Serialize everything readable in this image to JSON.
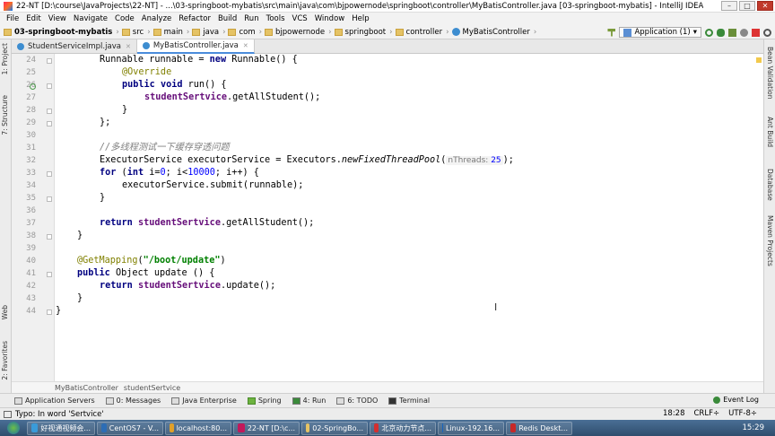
{
  "window": {
    "title": "22-NT [D:\\course\\JavaProjects\\22-NT] - ...\\03-springboot-mybatis\\src\\main\\java\\com\\bjpowernode\\springboot\\controller\\MyBatisController.java [03-springboot-mybatis] - IntelliJ IDEA"
  },
  "menu": [
    "File",
    "Edit",
    "View",
    "Navigate",
    "Code",
    "Analyze",
    "Refactor",
    "Build",
    "Run",
    "Tools",
    "VCS",
    "Window",
    "Help"
  ],
  "breadcrumb": [
    "03-springboot-mybatis",
    "src",
    "main",
    "java",
    "com",
    "bjpowernode",
    "springboot",
    "controller",
    "MyBatisController"
  ],
  "run_config": "Application (1)",
  "tabs": [
    {
      "label": "StudentServiceImpl.java"
    },
    {
      "label": "MyBatisController.java"
    }
  ],
  "left_tools": [
    "1: Project",
    "7: Structure",
    "Web",
    "2: Favorites"
  ],
  "right_tools": [
    "Bean Validation",
    "Ant Build",
    "Database",
    "Maven Projects"
  ],
  "line_numbers": [
    "24",
    "25",
    "26",
    "27",
    "28",
    "29",
    "30",
    "31",
    "32",
    "33",
    "34",
    "35",
    "36",
    "37",
    "38",
    "39",
    "40",
    "41",
    "42",
    "43",
    "44"
  ],
  "code": {
    "l24": {
      "a": "Runnable runnable = ",
      "b": "new",
      "c": " Runnable() {"
    },
    "l25": {
      "a": "@Override"
    },
    "l26": {
      "a": "public",
      "b": " ",
      "c": "void",
      "d": " run() {"
    },
    "l27": {
      "a": "studentSertvice",
      "b": ".getAllStudent();"
    },
    "l28": {
      "a": "}"
    },
    "l29": {
      "a": "};"
    },
    "l31": {
      "a": "//多线程测试一下缓存穿透问题"
    },
    "l32": {
      "a": "ExecutorService executorService = Executors.",
      "b": "newFixedThreadPool",
      "c": "(",
      "hint_name": "nThreads:",
      "hint_val": "25",
      "d": ");"
    },
    "l33": {
      "a": "for",
      "b": " (",
      "c": "int",
      "d": " i=",
      "e": "0",
      "f": "; i<",
      "g": "10000",
      "h": "; i++) {"
    },
    "l34": {
      "a": "executorService.submit(runnable);"
    },
    "l35": {
      "a": "}"
    },
    "l37": {
      "a": "return",
      "b": " ",
      "c": "studentSertvice",
      "d": ".getAllStudent();"
    },
    "l38": {
      "a": "}"
    },
    "l40": {
      "a": "@GetMapping",
      "b": "(",
      "c": "\"/boot/update\"",
      "d": ")"
    },
    "l41": {
      "a": "public",
      "b": " Object update () {"
    },
    "l42": {
      "a": "return",
      "b": " ",
      "c": "studentSertvice",
      "d": ".update();"
    },
    "l43": {
      "a": "}"
    },
    "l44": {
      "a": "}"
    }
  },
  "code_crumbs": [
    "MyBatisController",
    "studentSertvice"
  ],
  "tool_windows": [
    "Application Servers",
    "0: Messages",
    "Java Enterprise",
    "Spring",
    "4: Run",
    "6: TODO",
    "Terminal"
  ],
  "event_log": "Event Log",
  "status": {
    "message": "Typo: In word 'Sertvice'",
    "position": "18:28",
    "line_sep": "CRLF÷",
    "encoding": "UTF-8÷"
  },
  "taskbar": [
    {
      "label": "好视通视频会...",
      "color": "#3a9bd9"
    },
    {
      "label": "CentOS7 - V...",
      "color": "#2d6db5"
    },
    {
      "label": "localhost:80...",
      "color": "#e0a02a"
    },
    {
      "label": "22-NT [D:\\c...",
      "color": "#c2185b"
    },
    {
      "label": "02-SpringBo...",
      "color": "#e5c365"
    },
    {
      "label": "北京动力节点...",
      "color": "#d32f2f"
    },
    {
      "label": "Linux-192.16...",
      "color": "#1565c0"
    },
    {
      "label": "Redis Deskt...",
      "color": "#c62828"
    }
  ],
  "clock": "15:29",
  "colors": {
    "keyword": "#000080",
    "annotation": "#808000",
    "field": "#660e7a",
    "comment": "#808080",
    "number": "#0000ff",
    "string": "#008000"
  }
}
